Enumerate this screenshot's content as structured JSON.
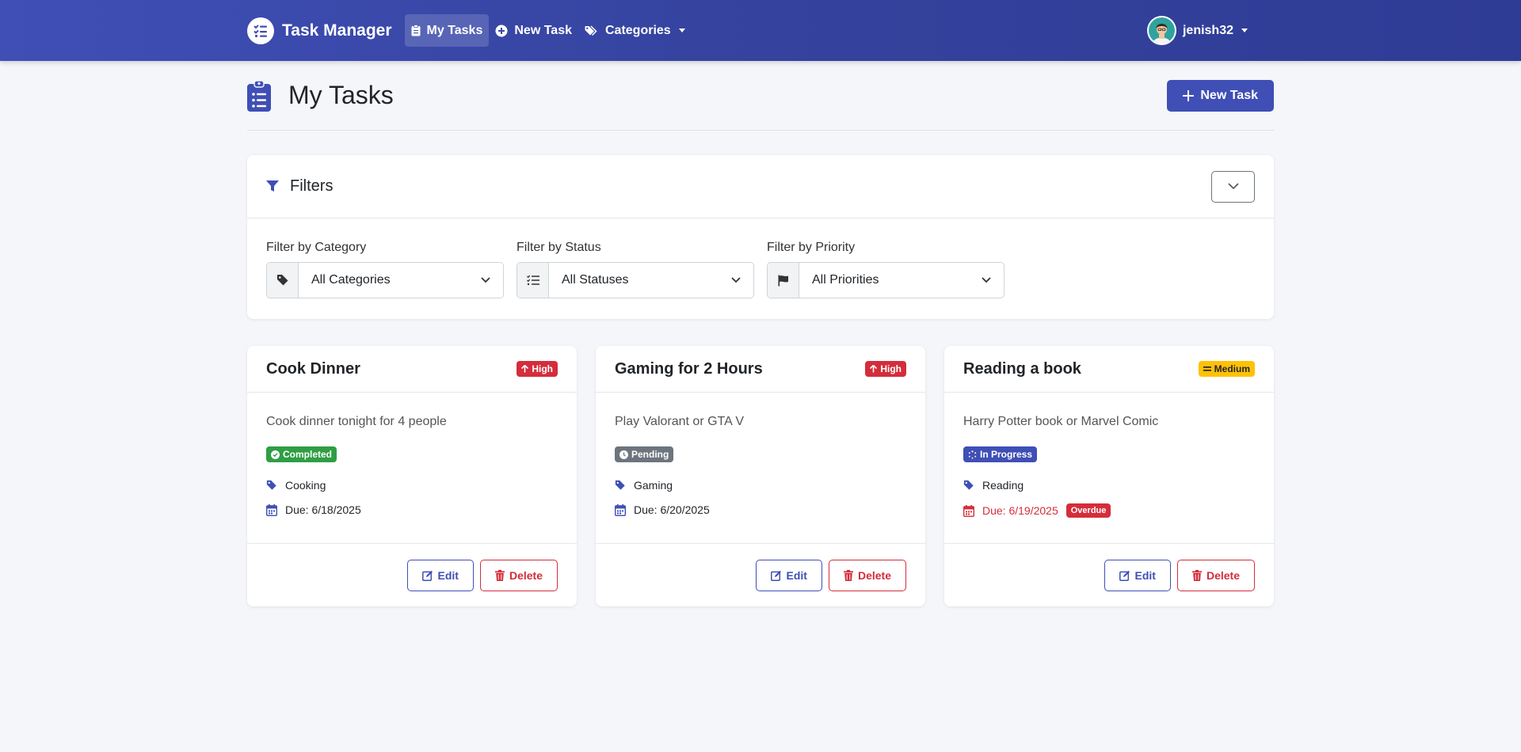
{
  "navbar": {
    "brand": "Task Manager",
    "items": [
      {
        "label": "My Tasks",
        "icon": "clipboard-icon"
      },
      {
        "label": "New Task",
        "icon": "plus-circle-icon"
      },
      {
        "label": "Categories",
        "icon": "tags-icon"
      }
    ],
    "user": "jenish32"
  },
  "page": {
    "title": "My Tasks",
    "new_task_label": "New Task"
  },
  "filters": {
    "title": "Filters",
    "groups": [
      {
        "label": "Filter by Category",
        "value": "All Categories",
        "icon": "tag-icon"
      },
      {
        "label": "Filter by Status",
        "value": "All Statuses",
        "icon": "list-check-icon"
      },
      {
        "label": "Filter by Priority",
        "value": "All Priorities",
        "icon": "flag-icon"
      }
    ]
  },
  "tasks": [
    {
      "title": "Cook Dinner",
      "priority": "High",
      "description": "Cook dinner tonight for 4 people",
      "status": "Completed",
      "category": "Cooking",
      "due": "Due: 6/18/2025",
      "overdue": false
    },
    {
      "title": "Gaming for 2 Hours",
      "priority": "High",
      "description": "Play Valorant or GTA V",
      "status": "Pending",
      "category": "Gaming",
      "due": "Due: 6/20/2025",
      "overdue": false
    },
    {
      "title": "Reading a book",
      "priority": "Medium",
      "description": "Harry Potter book or Marvel Comic",
      "status": "In Progress",
      "category": "Reading",
      "due": "Due: 6/19/2025",
      "overdue": true,
      "overdue_label": "Overdue"
    }
  ],
  "actions": {
    "edit": "Edit",
    "delete": "Delete"
  },
  "colors": {
    "primary": "#3f4fb6",
    "danger": "#d42d3b",
    "success": "#2e9e44",
    "warning": "#ffc107",
    "secondary": "#6c757d"
  }
}
